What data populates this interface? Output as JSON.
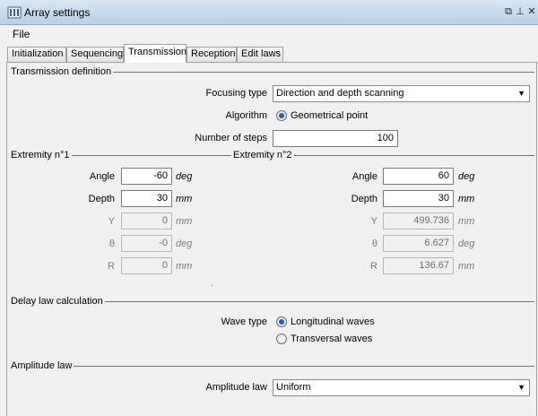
{
  "window": {
    "title": "Array settings",
    "icon": "array-probe-icon",
    "buttons": [
      "restore-icon",
      "pin-icon",
      "close-icon"
    ],
    "glyphs": {
      "restore": "⧉",
      "pin": "⊥",
      "close": "✕"
    }
  },
  "menu": {
    "file": "File"
  },
  "tabs": [
    {
      "label": "Initialization"
    },
    {
      "label": "Sequencing"
    },
    {
      "label": "Transmission",
      "active": true
    },
    {
      "label": "Reception"
    },
    {
      "label": "Edit laws"
    }
  ],
  "transmission": {
    "section_title": "Transmission definition",
    "focusing_type_label": "Focusing type",
    "focusing_type_value": "Direction and depth scanning",
    "algorithm_label": "Algorithm",
    "algorithm_value": "Geometrical point",
    "steps_label": "Number of steps",
    "steps_value": "100"
  },
  "extremity1": {
    "title": "Extremity n°1",
    "angle_label": "Angle",
    "angle_value": "-60",
    "angle_unit": "deg",
    "depth_label": "Depth",
    "depth_value": "30",
    "depth_unit": "mm",
    "y_label": "Y",
    "y_value": "0",
    "y_unit": "mm",
    "theta_label": "θ",
    "theta_value": "-0",
    "theta_unit": "deg",
    "r_label": "R",
    "r_value": "0",
    "r_unit": "mm"
  },
  "extremity2": {
    "title": "Extremity n°2",
    "angle_label": "Angle",
    "angle_value": "60",
    "angle_unit": "deg",
    "depth_label": "Depth",
    "depth_value": "30",
    "depth_unit": "mm",
    "y_label": "Y",
    "y_value": "499.736",
    "y_unit": "mm",
    "theta_label": "θ",
    "theta_value": "6.627",
    "theta_unit": "deg",
    "r_label": "R",
    "r_value": "136.67",
    "r_unit": "mm"
  },
  "delay": {
    "section_title": "Delay law calculation",
    "wave_type_label": "Wave type",
    "options": [
      "Longitudinal waves",
      "Transversal waves"
    ],
    "selected": "Longitudinal waves"
  },
  "amplitude": {
    "section_title": "Amplitude law",
    "label": "Amplitude law",
    "value": "Uniform"
  },
  "dropdown_arrow": "▼"
}
